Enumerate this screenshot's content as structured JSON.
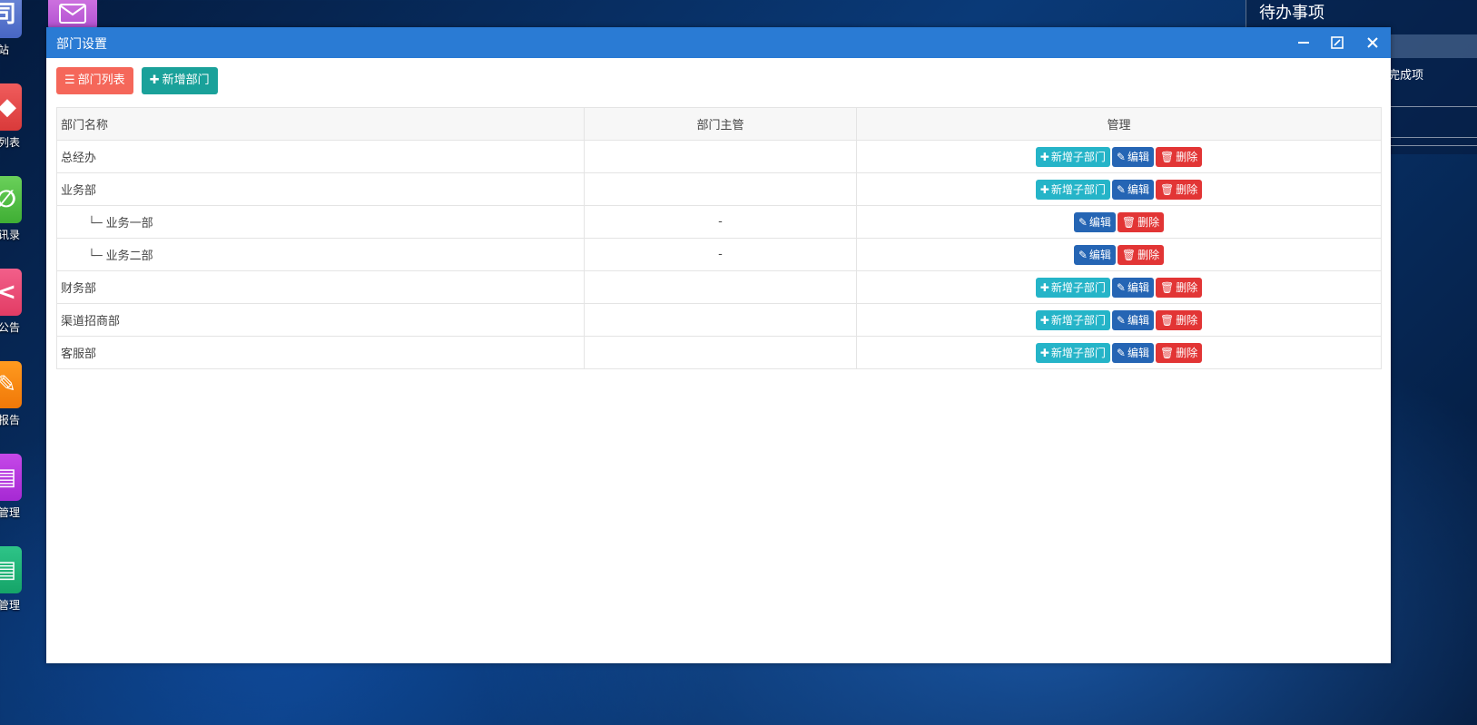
{
  "desktop": {
    "icons": [
      {
        "label": "站",
        "color_top": "#6f8ad8",
        "color_bottom": "#4766c4",
        "glyph": "司"
      },
      {
        "label": "列表",
        "color_top": "#f05c5c",
        "color_bottom": "#d93a3a",
        "glyph": "◆"
      },
      {
        "label": "讯录",
        "color_top": "#6ad05a",
        "color_bottom": "#3fae34",
        "glyph": "∅"
      },
      {
        "label": "公告",
        "color_top": "#f25f8a",
        "color_bottom": "#e23c64",
        "glyph": "<"
      },
      {
        "label": "报告",
        "color_top": "#ff9a1f",
        "color_bottom": "#f07808",
        "glyph": "✎"
      },
      {
        "label": "管理",
        "color_top": "#c548e8",
        "color_bottom": "#a629d3",
        "glyph": "▤"
      },
      {
        "label": "管理",
        "color_top": "#2ec488",
        "color_bottom": "#15a468",
        "glyph": "▤"
      }
    ],
    "mail_icon": "mail-icon"
  },
  "right_panel": {
    "title": "待办事项",
    "text": "完成项"
  },
  "window": {
    "title": "部门设置",
    "title_bar_color": "#2a7bd4"
  },
  "toolbar": {
    "list_label": "部门列表",
    "add_label": "新增部门"
  },
  "table": {
    "headers": [
      "部门名称",
      "部门主管",
      "管理"
    ],
    "rows": [
      {
        "name": "总经办",
        "manager": "",
        "child": false
      },
      {
        "name": "业务部",
        "manager": "",
        "child": false
      },
      {
        "name": "业务一部",
        "manager": "-",
        "child": true
      },
      {
        "name": "业务二部",
        "manager": "-",
        "child": true
      },
      {
        "name": "财务部",
        "manager": "",
        "child": false
      },
      {
        "name": "渠道招商部",
        "manager": "",
        "child": false
      },
      {
        "name": "客服部",
        "manager": "",
        "child": false
      }
    ],
    "actions": {
      "add_child": "新增子部门",
      "edit": "编辑",
      "delete": "删除"
    },
    "branch_glyph": "└─"
  }
}
